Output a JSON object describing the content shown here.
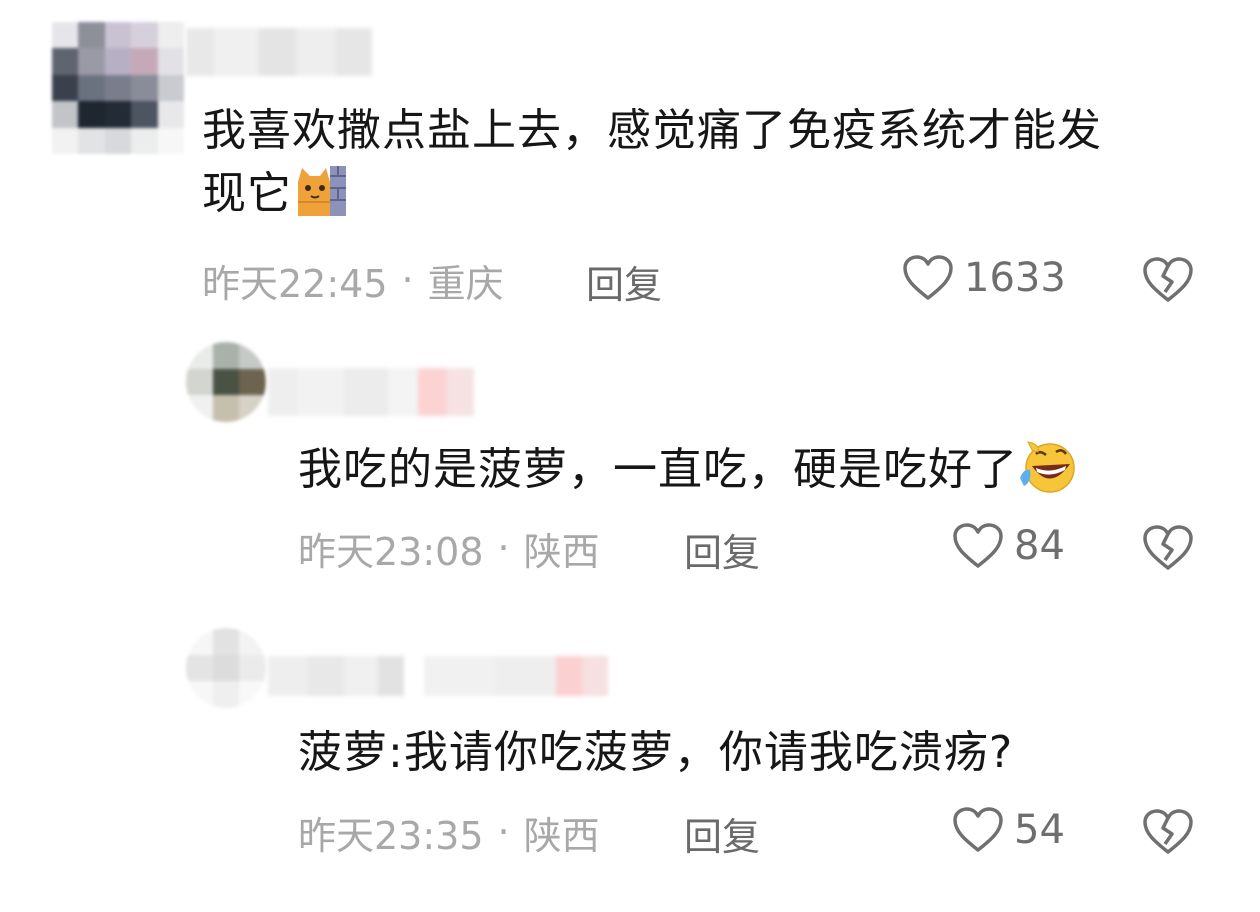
{
  "comments": [
    {
      "text_line1": "我喜欢撒点盐上去，感觉痛了免疫系统才能发",
      "text_line2": "现它",
      "time": "昨天22:45",
      "location": "重庆",
      "separator": "·",
      "reply_label": "回复",
      "likes": "1633",
      "emoji": "cat-hiding-icon"
    },
    {
      "text": "我吃的是菠萝，一直吃，硬是吃好了",
      "time": "昨天23:08",
      "location": "陕西",
      "separator": "·",
      "reply_label": "回复",
      "likes": "84",
      "emoji": "laughing-crying-icon"
    },
    {
      "text": "菠萝:我请你吃菠萝，你请我吃溃疡?",
      "time": "昨天23:35",
      "location": "陕西",
      "separator": "·",
      "reply_label": "回复",
      "likes": "54"
    }
  ],
  "colors": {
    "text": "#161616",
    "meta": "#a8a8a8",
    "reply": "#6a6a6a",
    "icon": "#707070",
    "emoji_yellow": "#f6c53a",
    "cat_orange": "#f0a23a"
  }
}
